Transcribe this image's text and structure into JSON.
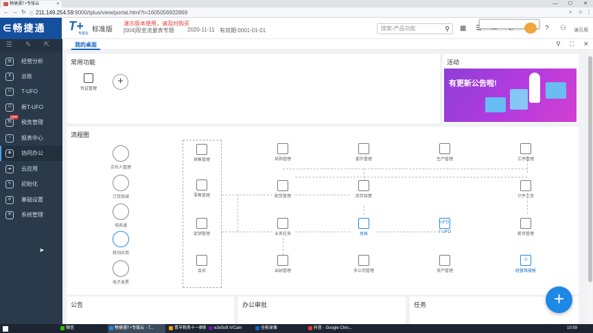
{
  "browser": {
    "tab_title": "畅捷通T+专版云",
    "url_host": "211.149.254.59",
    "url_rest": ":9000/tplus/view/portal.html?t=1605056932869",
    "min": "—",
    "max": "☐",
    "close": "✕"
  },
  "header": {
    "brand": "畅捷通",
    "product": "T+",
    "product_sub": "专属云",
    "edition": "标准版",
    "warning": "演示版本使用，请及时购买",
    "company": "[004]现金流量表专题",
    "date": "2020-11-11",
    "period": "有效期:0001-01-01",
    "search_placeholder": "搜索-产品功能",
    "username": "演示用"
  },
  "sidebar": {
    "items": [
      {
        "label": "经营分析",
        "icon": "chart-board-icon",
        "glyph": "▤"
      },
      {
        "label": "总账",
        "icon": "ledger-icon",
        "glyph": "¥"
      },
      {
        "label": "T-UFO",
        "icon": "ufo-icon",
        "glyph": "U"
      },
      {
        "label": "新T-UFO",
        "icon": "new-ufo-icon",
        "glyph": "U"
      },
      {
        "label": "税务管理",
        "icon": "tax-icon",
        "glyph": "税"
      },
      {
        "label": "报表中心",
        "icon": "report-icon",
        "glyph": "◔"
      },
      {
        "label": "协同办公",
        "icon": "collaboration-icon",
        "glyph": "◉"
      },
      {
        "label": "云应用",
        "icon": "cloud-icon",
        "glyph": "☁"
      },
      {
        "label": "初始化",
        "icon": "refresh-icon",
        "glyph": "↻"
      },
      {
        "label": "基础设置",
        "icon": "settings-icon",
        "glyph": "⚙"
      },
      {
        "label": "系统管理",
        "icon": "system-icon",
        "glyph": "⚒"
      }
    ],
    "new_badge": "new"
  },
  "tabs": {
    "desk": "我的桌面"
  },
  "common": {
    "title": "常用功能",
    "voucher": "凭证管理",
    "add": "+"
  },
  "activity": {
    "title": "活动",
    "banner_text": "有更新公告啦!"
  },
  "flow": {
    "title": "流程图",
    "left": [
      "合伙人管理",
      "订货商城",
      "电商通",
      "移动应用",
      "电子发票"
    ],
    "mid": [
      "销售管理",
      "零售管理",
      "促销管理",
      "会员"
    ],
    "row1": [
      "采购管理",
      "委外管理",
      "生产管理",
      "工序管理"
    ],
    "row2": [
      "配货管理",
      "库存核算",
      "计件工资"
    ],
    "row3": [
      "业务往来",
      "总账",
      "T-UFO",
      "薪资管理"
    ],
    "row4": [
      "出纳管理",
      "多公司管理",
      "资产管理",
      "经营驾驶舱"
    ]
  },
  "bottom": {
    "notice": "公告",
    "approval": "办公审批",
    "task": "任务"
  },
  "taskbar": {
    "items": [
      "微信",
      "畅捷通T+专版云 - T...",
      "青羊税务十一群聊5个...",
      "e2eSoft iVCam",
      "全能录像",
      "抖音 - Google Chro..."
    ],
    "time": "10:59"
  },
  "colors": {
    "brand": "#15509e",
    "accent": "#1e88e5",
    "warning": "#e53935",
    "sidebar": "#2b3a4a"
  }
}
